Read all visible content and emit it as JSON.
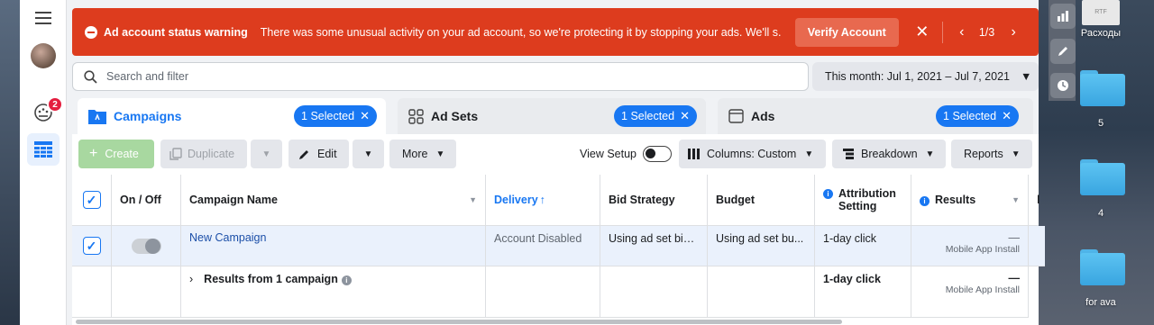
{
  "warning": {
    "title": "Ad account status warning",
    "message": "There was some unusual activity on your ad account, so we're protecting it by stopping your ads. We'll s...",
    "verify_label": "Verify Account",
    "page": "1/3"
  },
  "search": {
    "placeholder": "Search and filter"
  },
  "date_range": "This month: Jul 1, 2021 – Jul 7, 2021",
  "nav": {
    "notification_count": "2"
  },
  "tabs": [
    {
      "label": "Campaigns",
      "selected": "1 Selected"
    },
    {
      "label": "Ad Sets",
      "selected": "1 Selected"
    },
    {
      "label": "Ads",
      "selected": "1 Selected"
    }
  ],
  "toolbar": {
    "create": "Create",
    "duplicate": "Duplicate",
    "edit": "Edit",
    "more": "More",
    "view_setup": "View Setup",
    "columns": "Columns: Custom",
    "breakdown": "Breakdown",
    "reports": "Reports"
  },
  "table": {
    "headers": {
      "on_off": "On / Off",
      "campaign_name": "Campaign Name",
      "delivery": "Delivery",
      "bid_strategy": "Bid Strategy",
      "budget": "Budget",
      "attribution": "Attribution Setting",
      "results": "Results"
    },
    "rows": [
      {
        "name": "New Campaign",
        "delivery": "Account Disabled",
        "bid_strategy": "Using ad set bid...",
        "budget": "Using ad set bu...",
        "attribution": "1-day click",
        "results": "—",
        "results_sub": "Mobile App Install"
      }
    ],
    "summary": {
      "label": "Results from 1 campaign",
      "attribution": "1-day click",
      "results": "—",
      "results_sub": "Mobile App Install"
    }
  },
  "desktop": {
    "file_label": "Расходы",
    "file_type": "RTF",
    "folders": [
      "5",
      "4",
      "for ava"
    ]
  },
  "colors": {
    "warning": "#dd3c1e",
    "accent": "#1877f2",
    "create": "#a8d8a0"
  }
}
